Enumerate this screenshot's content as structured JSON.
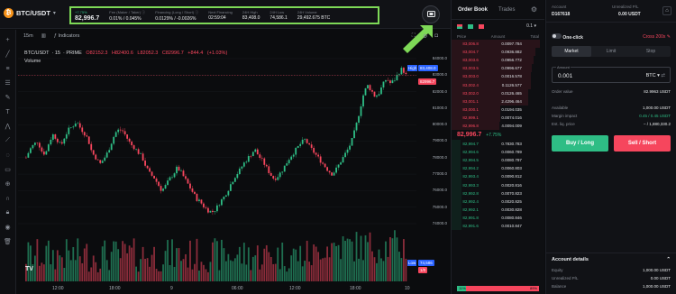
{
  "header": {
    "pair": "BTC/USDT",
    "coin_glyph": "₿",
    "stats": [
      {
        "label": "+7.75%",
        "value": "82,996.7",
        "label_green": true,
        "big": true
      },
      {
        "label": "Fee (Maker / Taker) ⓘ",
        "value": "0.01% / 0.045%"
      },
      {
        "label": "Financing (Long / Short) ⓘ",
        "value": "0.0129% / -0.0026%"
      },
      {
        "label": "Next Financing",
        "value": "02:59:04"
      },
      {
        "label": "24H High",
        "value": "83,408.0"
      },
      {
        "label": "24H Low",
        "value": "74,586.1"
      },
      {
        "label": "24H Volume",
        "value": "29,492.675 BTC"
      }
    ]
  },
  "chart_toolbar": {
    "interval": "15m",
    "indicators_label": "Indicators"
  },
  "chart": {
    "title_parts": [
      "BTC/USDT",
      "15",
      "PRIME"
    ],
    "ohlc": [
      "O82152.3",
      "H82400.6",
      "L82052.3",
      "C82996.7",
      "+844.4",
      "(+1.03%)"
    ],
    "volume_label": "Volume",
    "tv_label": "TV",
    "high_tag": "High",
    "high_value": "83,408.0",
    "last_tag": "82996.7",
    "low_tag": "Low",
    "low_value": "74,586",
    "low_sub": "1/0",
    "y_ticks": [
      "84000.0",
      "83000.0",
      "82000.0",
      "81000.0",
      "80000.0",
      "79000.0",
      "78000.0",
      "77000.0",
      "76000.0",
      "75000.0",
      "74000.0"
    ],
    "x_ticks": [
      "12:00",
      "18:00",
      "9",
      "06:00",
      "12:00",
      "18:00",
      "10"
    ]
  },
  "chart_data": {
    "type": "candlestick",
    "title": "BTC/USDT · 15 · PRIME",
    "x_ticks": [
      "12:00",
      "18:00",
      "9",
      "06:00",
      "12:00",
      "18:00",
      "10"
    ],
    "y_ticks": [
      84000,
      83000,
      82000,
      81000,
      80000,
      79000,
      78000,
      77000,
      76000,
      75000,
      74000
    ],
    "ylim": [
      74000,
      84600
    ],
    "high": 83408.0,
    "low": 74586.1,
    "last": 82996.7,
    "path_closes": [
      78000,
      78500,
      78800,
      79000,
      78400,
      78200,
      79000,
      79400,
      79100,
      78700,
      79300,
      79700,
      79900,
      80200,
      79800,
      79500,
      79100,
      78300,
      78000,
      77600,
      77900,
      78300,
      78900,
      79500,
      79700,
      79600,
      79200,
      78800,
      78600,
      78300,
      78000,
      77400,
      77000,
      76800,
      76400,
      76000,
      76300,
      76700,
      77000,
      77400,
      77100,
      76700,
      76300,
      75900,
      75500,
      75300,
      75000,
      74800,
      74700,
      74900,
      75300,
      75600,
      76000,
      76500,
      76900,
      77200,
      77600,
      77900,
      78200,
      78500,
      78100,
      77800,
      77400,
      77000,
      76700,
      76900,
      77200,
      77600,
      78000,
      78300,
      78600,
      78900,
      79100,
      78700,
      78400,
      78100,
      77800,
      77500,
      77200,
      77000,
      77300,
      77700,
      78100,
      78500,
      79000,
      79800,
      80800,
      81800,
      82400,
      82100,
      81700,
      81900,
      82400,
      82800,
      82500,
      82700,
      83100,
      83400,
      82996.7
    ]
  },
  "orderbook": {
    "tab_orderbook": "Order Book",
    "tab_trades": "Trades",
    "precision": "0.1",
    "headers": [
      "Price",
      "Amount",
      "Total"
    ],
    "asks": [
      {
        "price": "83,006.8",
        "amount": "0.009",
        "total": "7.784",
        "depth": 0.95
      },
      {
        "price": "83,004.7",
        "amount": "0.093",
        "total": "6.882",
        "depth": 0.9
      },
      {
        "price": "83,003.6",
        "amount": "0.095",
        "total": "6.772",
        "depth": 0.88
      },
      {
        "price": "83,003.5",
        "amount": "0.099",
        "total": "6.677",
        "depth": 0.86
      },
      {
        "price": "83,003.0",
        "amount": "0.001",
        "total": "6.578",
        "depth": 0.85
      },
      {
        "price": "83,002.4",
        "amount": "0.112",
        "total": "6.577",
        "depth": 0.85
      },
      {
        "price": "83,002.0",
        "amount": "0.012",
        "total": "6.465",
        "depth": 0.83
      },
      {
        "price": "83,001.1",
        "amount": "2.429",
        "total": "6.464",
        "depth": 0.83
      },
      {
        "price": "83,000.1",
        "amount": "0.019",
        "total": "4.035",
        "depth": 0.52
      },
      {
        "price": "82,999.1",
        "amount": "0.007",
        "total": "4.016",
        "depth": 0.52
      },
      {
        "price": "82,996.8",
        "amount": "4.009",
        "total": "4.009",
        "depth": 0.51
      }
    ],
    "mid_price": "82,996.7",
    "mid_change": "+7.75%",
    "bids": [
      {
        "price": "82,994.7",
        "amount": "0.783",
        "total": "0.783",
        "depth": 0.1
      },
      {
        "price": "82,994.6",
        "amount": "0.006",
        "total": "0.789",
        "depth": 0.1
      },
      {
        "price": "82,994.5",
        "amount": "0.008",
        "total": "0.797",
        "depth": 0.1
      },
      {
        "price": "82,994.2",
        "amount": "0.006",
        "total": "0.803",
        "depth": 0.1
      },
      {
        "price": "82,993.4",
        "amount": "0.009",
        "total": "0.812",
        "depth": 0.11
      },
      {
        "price": "82,993.3",
        "amount": "0.002",
        "total": "0.816",
        "depth": 0.11
      },
      {
        "price": "82,992.8",
        "amount": "0.007",
        "total": "0.823",
        "depth": 0.11
      },
      {
        "price": "82,992.4",
        "amount": "0.002",
        "total": "0.825",
        "depth": 0.11
      },
      {
        "price": "82,992.1",
        "amount": "0.003",
        "total": "0.828",
        "depth": 0.11
      },
      {
        "price": "82,991.8",
        "amount": "0.008",
        "total": "0.846",
        "depth": 0.11
      },
      {
        "price": "82,991.6",
        "amount": "0.001",
        "total": "0.847",
        "depth": 0.11
      }
    ],
    "buy_pct": "11%",
    "sell_pct": "89%",
    "buy_ratio": 0.11
  },
  "trade_panel": {
    "account_label": "Account",
    "account_id": "D167618",
    "unrealized_label": "Unrealized P/L",
    "unrealized_value": "0.00 USDT",
    "one_click_label": "One-click",
    "cross_label": "Cross 200x",
    "order_tabs": [
      "Market",
      "Limit",
      "Stop"
    ],
    "amount_label": "Amount",
    "amount_value": "0.001",
    "amount_currency": "BTC",
    "details": [
      {
        "k": "Order value",
        "v": "82.9963 USDT"
      },
      {
        "k": "",
        "v": ""
      },
      {
        "k": "Available",
        "v": "1,000.00 USDT"
      },
      {
        "k": "Margin impact",
        "v": "0.45 / 0.45 USDT"
      },
      {
        "k": "Est. liq. price",
        "v": "– / 1,880,330.2"
      }
    ],
    "buy_label": "Buy / Long",
    "sell_label": "Sell / Short",
    "account_details_label": "Account details",
    "acct_rows": [
      {
        "k": "Equity",
        "v": "1,000.00 USDT"
      },
      {
        "k": "Unrealized P/L",
        "v": "0.00 USDT"
      },
      {
        "k": "Balance",
        "v": "1,000.00 USDT"
      }
    ],
    "colors": {
      "long": "#2ebd85",
      "short": "#f6465d",
      "highlight": "#7ed957"
    }
  }
}
